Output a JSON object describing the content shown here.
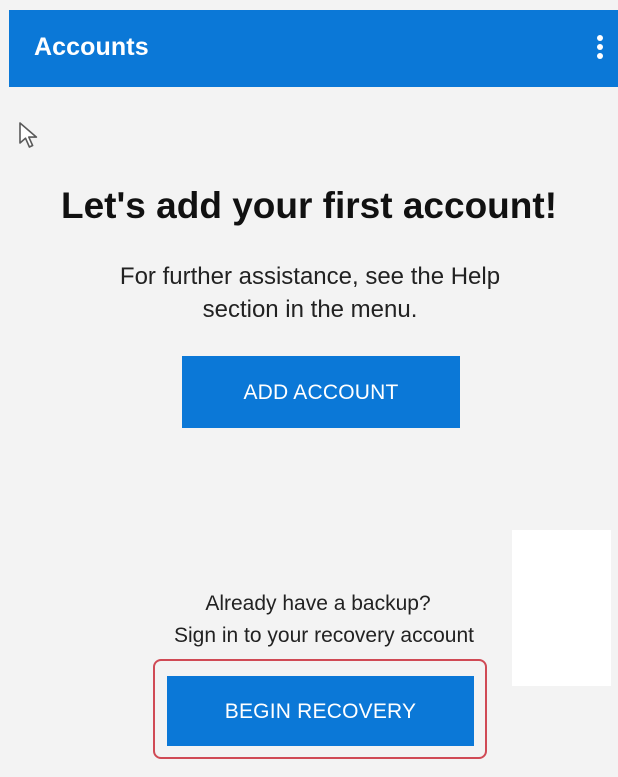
{
  "app_bar": {
    "title": "Accounts",
    "background_color": "#0b78d7",
    "menu_icon": "more-vertical-icon"
  },
  "cursor": {
    "icon": "mouse-pointer-icon"
  },
  "empty_state": {
    "heading": "Let's add your first account!",
    "help_text": "For further assistance, see the Help section in the menu.",
    "add_account_label": "ADD ACCOUNT"
  },
  "recovery": {
    "question": "Already have a backup?",
    "prompt": "Sign in to your recovery account",
    "button_label": "BEGIN RECOVERY",
    "highlight_color": "#d04a55"
  }
}
